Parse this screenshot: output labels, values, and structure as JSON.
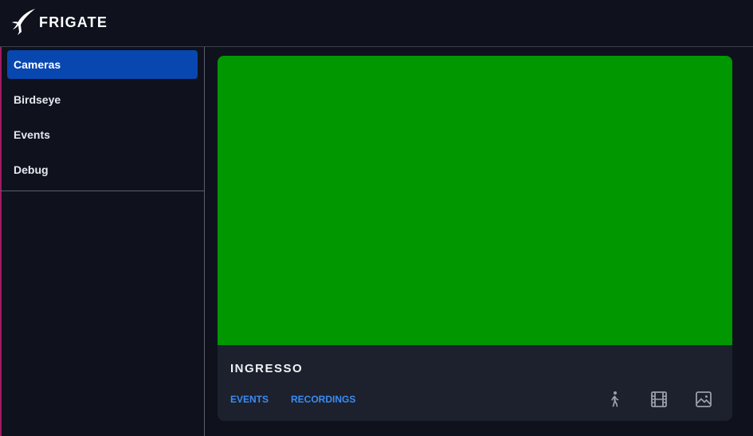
{
  "header": {
    "brand": "FRIGATE",
    "logo_icon": "frigate-bird-icon"
  },
  "sidebar": {
    "items": [
      {
        "label": "Cameras",
        "active": true
      },
      {
        "label": "Birdseye",
        "active": false
      },
      {
        "label": "Events",
        "active": false
      },
      {
        "label": "Debug",
        "active": false
      }
    ]
  },
  "camera": {
    "name": "INGRESSO",
    "links": {
      "events": "EVENTS",
      "recordings": "RECORDINGS"
    },
    "icons": [
      "motion-person-icon",
      "film-icon",
      "image-icon"
    ]
  },
  "colors": {
    "background": "#0f121d",
    "accent_active": "#0847b0",
    "link": "#3b8cf6",
    "feed": "#009700",
    "card": "#1c212d",
    "edge_accent": "#a11a63"
  }
}
